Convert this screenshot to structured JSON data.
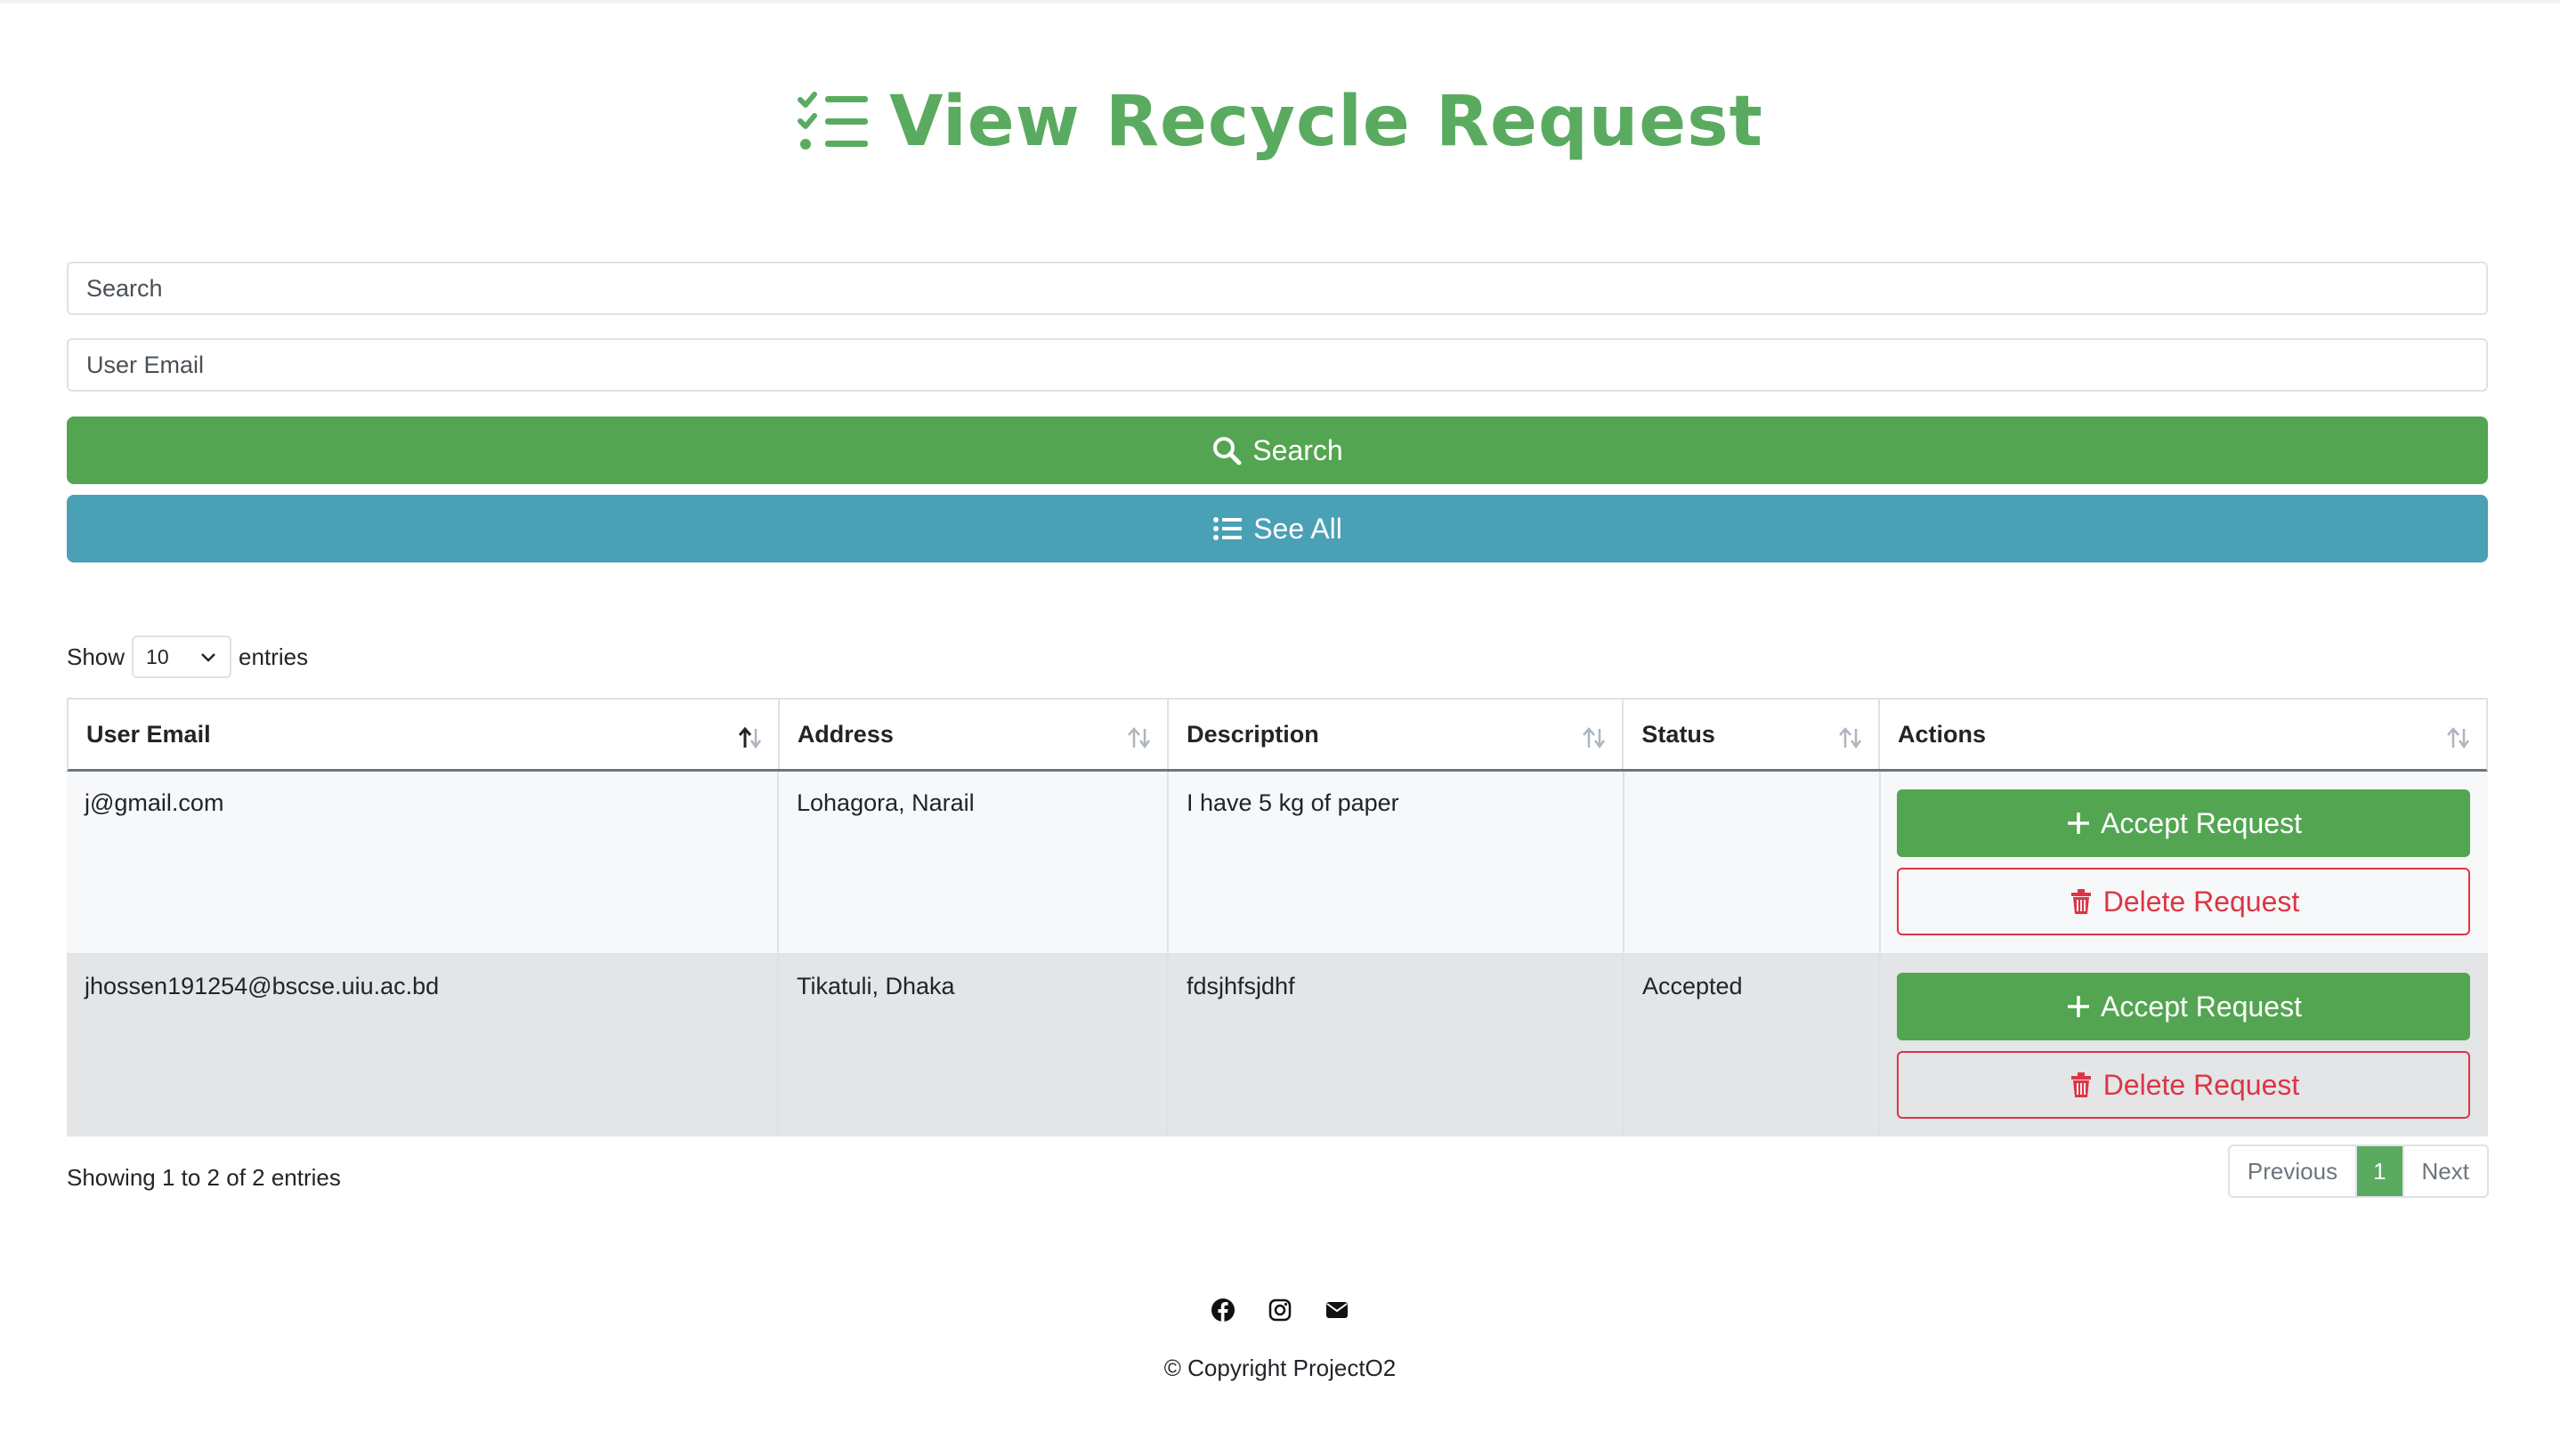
{
  "title": "View Recycle Request",
  "search": {
    "placeholder": "Search"
  },
  "email": {
    "placeholder": "User Email"
  },
  "buttons": {
    "search": "Search",
    "see_all": "See All"
  },
  "show_entries": {
    "show": "Show",
    "value": "10",
    "entries": "entries"
  },
  "table": {
    "headers": [
      "User Email",
      "Address",
      "Description",
      "Status",
      "Actions"
    ],
    "rows": [
      {
        "email": "j@gmail.com",
        "address": "Lohagora, Narail",
        "description": "I have 5 kg of paper",
        "status": ""
      },
      {
        "email": "jhossen191254@bscse.uiu.ac.bd",
        "address": "Tikatuli, Dhaka",
        "description": "fdsjhfsjdhf",
        "status": "Accepted"
      }
    ],
    "accept_label": "Accept Request",
    "delete_label": "Delete Request"
  },
  "info": "Showing 1 to 2 of 2 entries",
  "pagination": {
    "previous": "Previous",
    "current": "1",
    "next": "Next"
  },
  "footer": {
    "icons": [
      "facebook-icon",
      "instagram-icon",
      "envelope-icon"
    ],
    "copyright": "© Copyright ProjectO2"
  },
  "colors": {
    "primary_green": "#53a552",
    "title_green": "#5aab60",
    "info_blue": "#4aa0b5",
    "danger": "#dc3545"
  }
}
